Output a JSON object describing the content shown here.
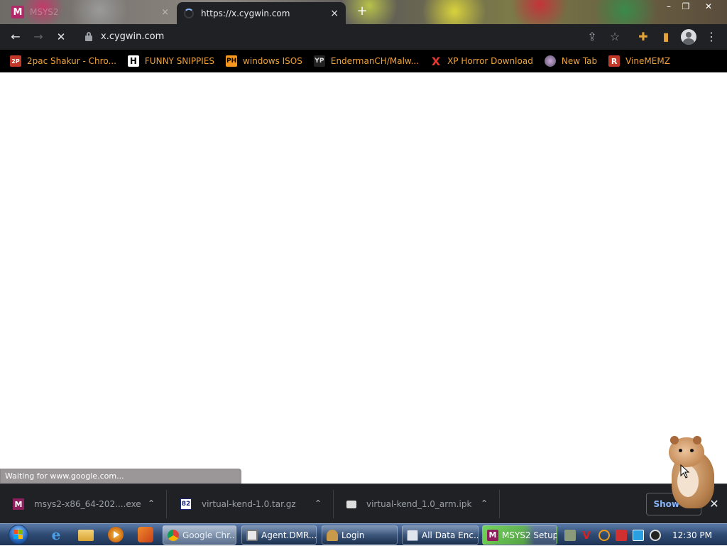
{
  "tabs": {
    "inactive": {
      "favicon": "msys2-icon",
      "favicon_letter": "M",
      "title": "MSYS2",
      "close": "×"
    },
    "active": {
      "title": "https://x.cygwin.com",
      "close": "×",
      "loading": true
    },
    "new_tab": "+"
  },
  "window_controls": {
    "minimize": "–",
    "maximize": "❐",
    "close": "✕"
  },
  "toolbar": {
    "back": "←",
    "forward": "→",
    "stop": "✕",
    "url": "x.cygwin.com",
    "share": "⇪",
    "star": "☆",
    "extensions": "✚",
    "side_panel": "▮",
    "menu": "⋮"
  },
  "bookmarks": [
    {
      "label": "2pac Shakur - Chro...",
      "icon": "tupac-icon",
      "glyph": "2P"
    },
    {
      "label": "FUNNY SNIPPIES",
      "icon": "h-icon",
      "glyph": "H"
    },
    {
      "label": "windows ISOS",
      "icon": "ph-icon",
      "glyph": "PH"
    },
    {
      "label": "EndermanCH/Malw...",
      "icon": "yp-icon",
      "glyph": "YP"
    },
    {
      "label": "XP Horror Download",
      "icon": "x-icon",
      "glyph": "X"
    },
    {
      "label": "New Tab",
      "icon": "globe-icon",
      "glyph": ""
    },
    {
      "label": "VineMEMZ",
      "icon": "r-icon",
      "glyph": "R"
    }
  ],
  "status_bar": "Waiting for www.google.com...",
  "downloads": [
    {
      "name": "msys2-x86_64-202....exe",
      "icon": "msys2-icon",
      "glyph": "M"
    },
    {
      "name": "virtual-kend-1.0.tar.gz",
      "icon": "archive-icon",
      "glyph": "82"
    },
    {
      "name": "virtual-kend_1.0_arm.ipk",
      "icon": "file-icon",
      "glyph": ""
    }
  ],
  "download_chevron": "⌃",
  "show_all_label": "Show all",
  "shelf_close": "✕",
  "taskbar": {
    "pins": [
      "internet-explorer-icon",
      "file-explorer-icon",
      "media-player-icon",
      "bittorrent-icon"
    ],
    "ie_glyph": "e",
    "tasks": [
      {
        "id": "chrome",
        "label": "Google Chr..."
      },
      {
        "id": "agent",
        "label": "Agent.DMR..."
      },
      {
        "id": "login",
        "label": "Login"
      },
      {
        "id": "alldata",
        "label": "All Data Enc..."
      },
      {
        "id": "msys2",
        "label": "MSYS2 Setup",
        "glyph": "M"
      }
    ],
    "tray_v": "V",
    "clock": "12:30 PM"
  },
  "colors": {
    "chrome_dark": "#202124",
    "bookmark_text": "#f0a23a",
    "link_blue": "#8ab4f8",
    "taskbar_blue": "#2e4a72",
    "progress_green": "#78e650"
  }
}
